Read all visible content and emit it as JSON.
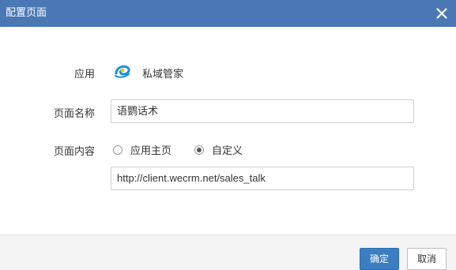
{
  "dialog": {
    "title": "配置页面"
  },
  "form": {
    "app_label": "应用",
    "app_name": "私域管家",
    "page_name_label": "页面名称",
    "page_name_value": "语鹦话术",
    "page_content_label": "页面内容",
    "radio_options": [
      {
        "label": "应用主页",
        "checked": false
      },
      {
        "label": "自定义",
        "checked": true
      }
    ],
    "url_value": "http://client.wecrm.net/sales_talk"
  },
  "footer": {
    "confirm_label": "确定",
    "cancel_label": "取消"
  },
  "colors": {
    "titlebar": "#4a78b4",
    "primary_button": "#3c7ec2",
    "app_icon_blue": "#1a8fe0",
    "app_icon_yellow": "#f2c21c"
  },
  "icons": {
    "close": "close-icon",
    "app": "app-logo-icon"
  }
}
